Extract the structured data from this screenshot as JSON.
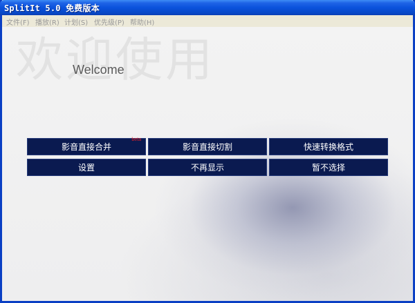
{
  "window": {
    "title": "SplitIt 5.0 免费版本"
  },
  "menu": [
    {
      "label": "文件(F)"
    },
    {
      "label": "播放(R)"
    },
    {
      "label": "计划(S)"
    },
    {
      "label": "优先级(P)"
    },
    {
      "label": "帮助(H)"
    }
  ],
  "hero": {
    "big_text": "欢迎使用",
    "welcome": "Welcome"
  },
  "buttons": {
    "merge": "影音直接合并",
    "merge_badge": "beta",
    "cut": "影音直接切割",
    "convert": "快速转换格式",
    "settings": "设置",
    "no_show": "不再显示",
    "skip": "暂不选择"
  }
}
